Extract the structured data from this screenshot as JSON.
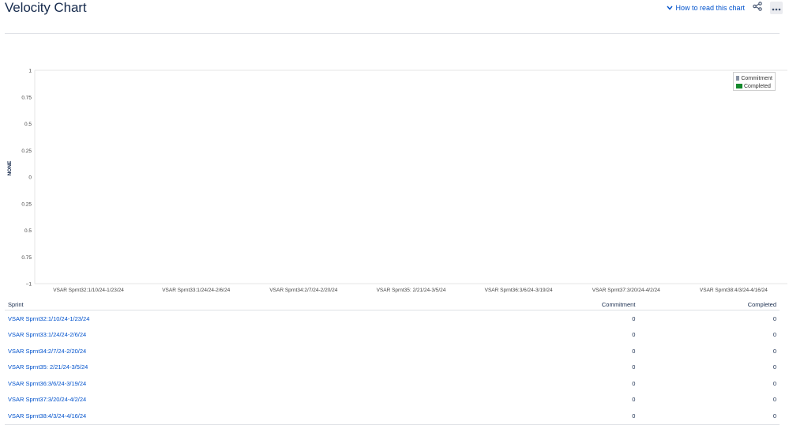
{
  "header": {
    "title": "Velocity Chart",
    "how_to_read_label": "How to read this chart"
  },
  "icons": {
    "chevron": "chevron-down-icon",
    "share": "share-icon",
    "more": "more-icon"
  },
  "colors": {
    "commitment": "#8993a4",
    "completed": "#14892c",
    "link": "#0052cc"
  },
  "chart_data": {
    "type": "bar",
    "ylabel": "NONE",
    "ylim": [
      -1,
      1
    ],
    "y_ticks": [
      "1",
      "0.75",
      "0.5",
      "0.25",
      "0",
      "0.25",
      "0.5",
      "0.75",
      "−1"
    ],
    "categories": [
      "VSAR Sprnt32:1/10/24-1/23/24",
      "VSAR Sprnt33:1/24/24-2/6/24",
      "VSAR Sprnt34:2/7/24-2/20/24",
      "VSAR Sprnt35: 2/21/24-3/5/24",
      "VSAR Sprnt36:3/6/24-3/19/24",
      "VSAR Sprnt37:3/20/24-4/2/24",
      "VSAR Sprnt38:4/3/24-4/16/24"
    ],
    "series": [
      {
        "name": "Commitment",
        "values": [
          0,
          0,
          0,
          0,
          0,
          0,
          0
        ]
      },
      {
        "name": "Completed",
        "values": [
          0,
          0,
          0,
          0,
          0,
          0,
          0
        ]
      }
    ],
    "legend_position": "top-right"
  },
  "table": {
    "headers": {
      "sprint": "Sprint",
      "commitment": "Commitment",
      "completed": "Completed"
    },
    "rows": [
      {
        "sprint": "VSAR Sprnt32:1/10/24-1/23/24",
        "commitment": "0",
        "completed": "0"
      },
      {
        "sprint": "VSAR Sprnt33:1/24/24-2/6/24",
        "commitment": "0",
        "completed": "0"
      },
      {
        "sprint": "VSAR Sprnt34:2/7/24-2/20/24",
        "commitment": "0",
        "completed": "0"
      },
      {
        "sprint": "VSAR Sprnt35: 2/21/24-3/5/24",
        "commitment": "0",
        "completed": "0"
      },
      {
        "sprint": "VSAR Sprnt36:3/6/24-3/19/24",
        "commitment": "0",
        "completed": "0"
      },
      {
        "sprint": "VSAR Sprnt37:3/20/24-4/2/24",
        "commitment": "0",
        "completed": "0"
      },
      {
        "sprint": "VSAR Sprnt38:4/3/24-4/16/24",
        "commitment": "0",
        "completed": "0"
      }
    ]
  }
}
